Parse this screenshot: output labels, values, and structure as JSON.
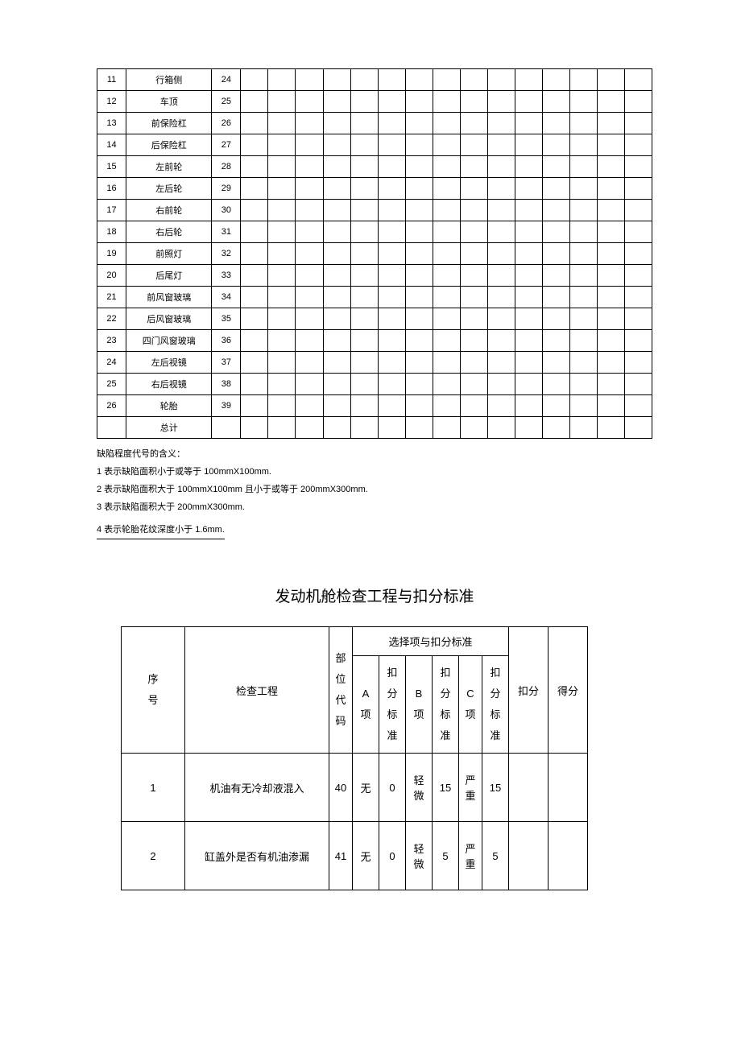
{
  "table1": {
    "rows": [
      {
        "n": "11",
        "label": "行箱侧",
        "code": "24"
      },
      {
        "n": "12",
        "label": "车顶",
        "code": "25"
      },
      {
        "n": "13",
        "label": "前保险杠",
        "code": "26"
      },
      {
        "n": "14",
        "label": "后保险杠",
        "code": "27"
      },
      {
        "n": "15",
        "label": "左前轮",
        "code": "28"
      },
      {
        "n": "16",
        "label": "左后轮",
        "code": "29"
      },
      {
        "n": "17",
        "label": "右前轮",
        "code": "30"
      },
      {
        "n": "18",
        "label": "右后轮",
        "code": "31"
      },
      {
        "n": "19",
        "label": "前照灯",
        "code": "32"
      },
      {
        "n": "20",
        "label": "后尾灯",
        "code": "33"
      },
      {
        "n": "21",
        "label": "前风窗玻璃",
        "code": "34"
      },
      {
        "n": "22",
        "label": "后风窗玻璃",
        "code": "35"
      },
      {
        "n": "23",
        "label": "四门风窗玻璃",
        "code": "36"
      },
      {
        "n": "24",
        "label": "左后视镜",
        "code": "37"
      },
      {
        "n": "25",
        "label": "右后视镜",
        "code": "38"
      },
      {
        "n": "26",
        "label": "轮胎",
        "code": "39"
      }
    ],
    "totalLabel": "总计"
  },
  "notes": {
    "intro": "缺陷程度代号的含义：",
    "l1": "1 表示缺陷面积小于或等于 100mmX100mm.",
    "l2": "2 表示缺陷面积大于 100mmX100mm 且小于或等于 200mmX300mm.",
    "l3": "3 表示缺陷面积大于 200mmX300mm.",
    "l4": "4 表示轮胎花纹深度小于 1.6mm."
  },
  "title2": "发动机舱检查工程与扣分标准",
  "table2": {
    "head": {
      "seq": "序号",
      "item": "检查工程",
      "partCode": "部位代码",
      "selHeader": "选择项与扣分标准",
      "a": "A项",
      "aStd": "扣分标准",
      "b": "B项",
      "bStd": "扣分标准",
      "c": "C项",
      "cStd": "扣分标准",
      "deduct": "扣分",
      "score": "得分"
    },
    "rows": [
      {
        "n": "1",
        "item": "机油有无冷却液混入",
        "code": "40",
        "a": "无",
        "aStd": "0",
        "b": "轻微",
        "bStd": "15",
        "c": "严重",
        "cStd": "15"
      },
      {
        "n": "2",
        "item": "缸盖外是否有机油渗漏",
        "code": "41",
        "a": "无",
        "aStd": "0",
        "b": "轻微",
        "bStd": "5",
        "c": "严重",
        "cStd": "5"
      }
    ]
  }
}
